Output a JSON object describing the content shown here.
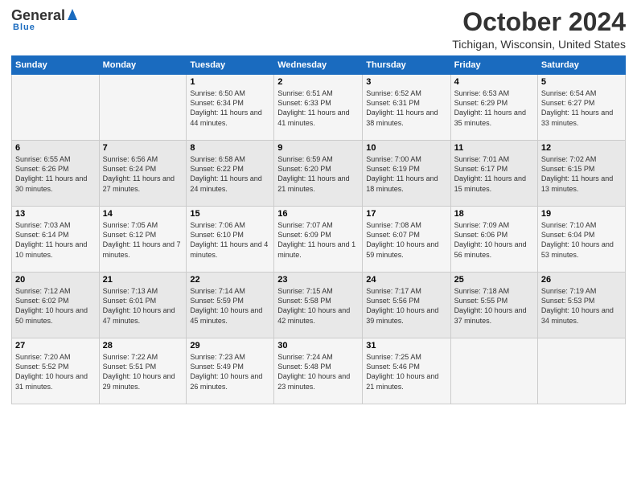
{
  "header": {
    "logo_general": "General",
    "logo_blue": "Blue",
    "month": "October 2024",
    "location": "Tichigan, Wisconsin, United States"
  },
  "days_of_week": [
    "Sunday",
    "Monday",
    "Tuesday",
    "Wednesday",
    "Thursday",
    "Friday",
    "Saturday"
  ],
  "weeks": [
    [
      {
        "num": "",
        "sunrise": "",
        "sunset": "",
        "daylight": ""
      },
      {
        "num": "",
        "sunrise": "",
        "sunset": "",
        "daylight": ""
      },
      {
        "num": "1",
        "sunrise": "Sunrise: 6:50 AM",
        "sunset": "Sunset: 6:34 PM",
        "daylight": "Daylight: 11 hours and 44 minutes."
      },
      {
        "num": "2",
        "sunrise": "Sunrise: 6:51 AM",
        "sunset": "Sunset: 6:33 PM",
        "daylight": "Daylight: 11 hours and 41 minutes."
      },
      {
        "num": "3",
        "sunrise": "Sunrise: 6:52 AM",
        "sunset": "Sunset: 6:31 PM",
        "daylight": "Daylight: 11 hours and 38 minutes."
      },
      {
        "num": "4",
        "sunrise": "Sunrise: 6:53 AM",
        "sunset": "Sunset: 6:29 PM",
        "daylight": "Daylight: 11 hours and 35 minutes."
      },
      {
        "num": "5",
        "sunrise": "Sunrise: 6:54 AM",
        "sunset": "Sunset: 6:27 PM",
        "daylight": "Daylight: 11 hours and 33 minutes."
      }
    ],
    [
      {
        "num": "6",
        "sunrise": "Sunrise: 6:55 AM",
        "sunset": "Sunset: 6:26 PM",
        "daylight": "Daylight: 11 hours and 30 minutes."
      },
      {
        "num": "7",
        "sunrise": "Sunrise: 6:56 AM",
        "sunset": "Sunset: 6:24 PM",
        "daylight": "Daylight: 11 hours and 27 minutes."
      },
      {
        "num": "8",
        "sunrise": "Sunrise: 6:58 AM",
        "sunset": "Sunset: 6:22 PM",
        "daylight": "Daylight: 11 hours and 24 minutes."
      },
      {
        "num": "9",
        "sunrise": "Sunrise: 6:59 AM",
        "sunset": "Sunset: 6:20 PM",
        "daylight": "Daylight: 11 hours and 21 minutes."
      },
      {
        "num": "10",
        "sunrise": "Sunrise: 7:00 AM",
        "sunset": "Sunset: 6:19 PM",
        "daylight": "Daylight: 11 hours and 18 minutes."
      },
      {
        "num": "11",
        "sunrise": "Sunrise: 7:01 AM",
        "sunset": "Sunset: 6:17 PM",
        "daylight": "Daylight: 11 hours and 15 minutes."
      },
      {
        "num": "12",
        "sunrise": "Sunrise: 7:02 AM",
        "sunset": "Sunset: 6:15 PM",
        "daylight": "Daylight: 11 hours and 13 minutes."
      }
    ],
    [
      {
        "num": "13",
        "sunrise": "Sunrise: 7:03 AM",
        "sunset": "Sunset: 6:14 PM",
        "daylight": "Daylight: 11 hours and 10 minutes."
      },
      {
        "num": "14",
        "sunrise": "Sunrise: 7:05 AM",
        "sunset": "Sunset: 6:12 PM",
        "daylight": "Daylight: 11 hours and 7 minutes."
      },
      {
        "num": "15",
        "sunrise": "Sunrise: 7:06 AM",
        "sunset": "Sunset: 6:10 PM",
        "daylight": "Daylight: 11 hours and 4 minutes."
      },
      {
        "num": "16",
        "sunrise": "Sunrise: 7:07 AM",
        "sunset": "Sunset: 6:09 PM",
        "daylight": "Daylight: 11 hours and 1 minute."
      },
      {
        "num": "17",
        "sunrise": "Sunrise: 7:08 AM",
        "sunset": "Sunset: 6:07 PM",
        "daylight": "Daylight: 10 hours and 59 minutes."
      },
      {
        "num": "18",
        "sunrise": "Sunrise: 7:09 AM",
        "sunset": "Sunset: 6:06 PM",
        "daylight": "Daylight: 10 hours and 56 minutes."
      },
      {
        "num": "19",
        "sunrise": "Sunrise: 7:10 AM",
        "sunset": "Sunset: 6:04 PM",
        "daylight": "Daylight: 10 hours and 53 minutes."
      }
    ],
    [
      {
        "num": "20",
        "sunrise": "Sunrise: 7:12 AM",
        "sunset": "Sunset: 6:02 PM",
        "daylight": "Daylight: 10 hours and 50 minutes."
      },
      {
        "num": "21",
        "sunrise": "Sunrise: 7:13 AM",
        "sunset": "Sunset: 6:01 PM",
        "daylight": "Daylight: 10 hours and 47 minutes."
      },
      {
        "num": "22",
        "sunrise": "Sunrise: 7:14 AM",
        "sunset": "Sunset: 5:59 PM",
        "daylight": "Daylight: 10 hours and 45 minutes."
      },
      {
        "num": "23",
        "sunrise": "Sunrise: 7:15 AM",
        "sunset": "Sunset: 5:58 PM",
        "daylight": "Daylight: 10 hours and 42 minutes."
      },
      {
        "num": "24",
        "sunrise": "Sunrise: 7:17 AM",
        "sunset": "Sunset: 5:56 PM",
        "daylight": "Daylight: 10 hours and 39 minutes."
      },
      {
        "num": "25",
        "sunrise": "Sunrise: 7:18 AM",
        "sunset": "Sunset: 5:55 PM",
        "daylight": "Daylight: 10 hours and 37 minutes."
      },
      {
        "num": "26",
        "sunrise": "Sunrise: 7:19 AM",
        "sunset": "Sunset: 5:53 PM",
        "daylight": "Daylight: 10 hours and 34 minutes."
      }
    ],
    [
      {
        "num": "27",
        "sunrise": "Sunrise: 7:20 AM",
        "sunset": "Sunset: 5:52 PM",
        "daylight": "Daylight: 10 hours and 31 minutes."
      },
      {
        "num": "28",
        "sunrise": "Sunrise: 7:22 AM",
        "sunset": "Sunset: 5:51 PM",
        "daylight": "Daylight: 10 hours and 29 minutes."
      },
      {
        "num": "29",
        "sunrise": "Sunrise: 7:23 AM",
        "sunset": "Sunset: 5:49 PM",
        "daylight": "Daylight: 10 hours and 26 minutes."
      },
      {
        "num": "30",
        "sunrise": "Sunrise: 7:24 AM",
        "sunset": "Sunset: 5:48 PM",
        "daylight": "Daylight: 10 hours and 23 minutes."
      },
      {
        "num": "31",
        "sunrise": "Sunrise: 7:25 AM",
        "sunset": "Sunset: 5:46 PM",
        "daylight": "Daylight: 10 hours and 21 minutes."
      },
      {
        "num": "",
        "sunrise": "",
        "sunset": "",
        "daylight": ""
      },
      {
        "num": "",
        "sunrise": "",
        "sunset": "",
        "daylight": ""
      }
    ]
  ]
}
